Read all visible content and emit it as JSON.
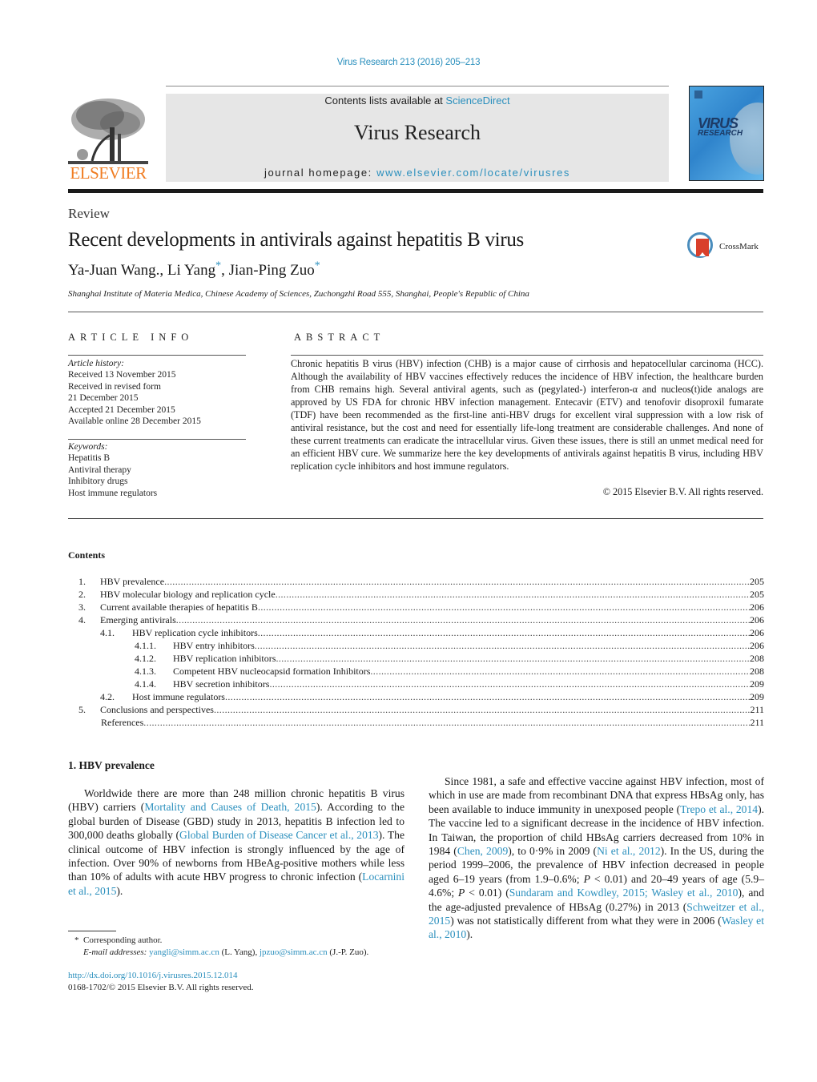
{
  "header": {
    "journal_ref": "Virus Research 213 (2016) 205–213",
    "contents_prefix": "Contents lists available at ",
    "contents_link": "ScienceDirect",
    "journal_name": "Virus Research",
    "homepage_prefix": "journal homepage: ",
    "homepage_link": "www.elsevier.com/locate/virusres",
    "publisher_logo_text": "ELSEVIER",
    "cover_title_1": "VIRUS",
    "cover_title_2": "RESEARCH",
    "crossmark_label": "CrossMark"
  },
  "article": {
    "type": "Review",
    "title": "Recent developments in antivirals against hepatitis B virus",
    "authors": [
      {
        "name": "Ya-Juan Wang.",
        "mark": ""
      },
      {
        "name": "Li Yang",
        "mark": "*"
      },
      {
        "name": "Jian-Ping Zuo",
        "mark": "*"
      }
    ],
    "author_sep": ", ",
    "affiliation": "Shanghai Institute of Materia Medica, Chinese Academy of Sciences, Zuchongzhi Road 555, Shanghai, People's Republic of China"
  },
  "article_info": {
    "heading": "ARTICLE INFO",
    "history_label": "Article history:",
    "history": [
      "Received 13 November 2015",
      "Received in revised form",
      "21 December 2015",
      "Accepted 21 December 2015",
      "Available online 28 December 2015"
    ],
    "keywords_label": "Keywords:",
    "keywords": [
      "Hepatitis B",
      "Antiviral therapy",
      "Inhibitory drugs",
      "Host immune regulators"
    ]
  },
  "abstract": {
    "heading": "ABSTRACT",
    "text": "Chronic hepatitis B virus (HBV) infection (CHB) is a major cause of cirrhosis and hepatocellular carcinoma (HCC). Although the availability of HBV vaccines effectively reduces the incidence of HBV infection, the healthcare burden from CHB remains high. Several antiviral agents, such as (pegylated-) interferon-α and nucleos(t)ide analogs are approved by US FDA for chronic HBV infection management. Entecavir (ETV) and tenofovir disoproxil fumarate (TDF) have been recommended as the first-line anti-HBV drugs for excellent viral suppression with a low risk of antiviral resistance, but the cost and need for essentially life-long treatment are considerable challenges. And none of these current treatments can eradicate the intracellular virus. Given these issues, there is still an unmet medical need for an efficient HBV cure. We summarize here the key developments of antivirals against hepatitis B virus, including HBV replication cycle inhibitors and host immune regulators.",
    "copyright": "© 2015 Elsevier B.V. All rights reserved."
  },
  "contents": {
    "heading": "Contents",
    "items": [
      {
        "num": "1.",
        "label": "HBV prevalence",
        "page": "205",
        "level": 0
      },
      {
        "num": "2.",
        "label": "HBV molecular biology and replication cycle",
        "page": "205",
        "level": 0
      },
      {
        "num": "3.",
        "label": "Current available therapies of hepatitis B",
        "page": "206",
        "level": 0
      },
      {
        "num": "4.",
        "label": "Emerging antivirals",
        "page": "206",
        "level": 0
      },
      {
        "num": "4.1.",
        "label": "HBV replication cycle inhibitors",
        "page": "206",
        "level": 1
      },
      {
        "num": "4.1.1.",
        "label": "HBV entry inhibitors",
        "page": "206",
        "level": 2
      },
      {
        "num": "4.1.2.",
        "label": "HBV replication inhibitors",
        "page": "208",
        "level": 2
      },
      {
        "num": "4.1.3.",
        "label": "Competent HBV nucleocapsid formation Inhibitors",
        "page": "208",
        "level": 2
      },
      {
        "num": "4.1.4.",
        "label": "HBV secretion inhibitors",
        "page": "209",
        "level": 2
      },
      {
        "num": "4.2.",
        "label": "Host immune regulators",
        "page": "209",
        "level": 1
      },
      {
        "num": "5.",
        "label": "Conclusions and perspectives",
        "page": "211",
        "level": 0
      },
      {
        "num": "",
        "label": "References",
        "page": "211",
        "level": 0
      }
    ]
  },
  "section1": {
    "heading": "1.  HBV prevalence",
    "para1": [
      {
        "t": "Worldwide there are more than 248 million chronic hepatitis B virus (HBV) carriers ("
      },
      {
        "t": "Mortality and Causes of Death, 2015",
        "link": true
      },
      {
        "t": "). According to the global burden of Disease (GBD) study in 2013, hepatitis B infection led to 300,000 deaths globally ("
      },
      {
        "t": "Global Burden of Disease Cancer et al., 2013",
        "link": true
      },
      {
        "t": "). The clinical outcome of HBV infection is strongly influenced by the age of infection. Over 90% of newborns from HBeAg-positive mothers while less than 10% of adults with acute HBV progress to chronic infection ("
      },
      {
        "t": "Locarnini et al., 2015",
        "link": true
      },
      {
        "t": ")."
      }
    ],
    "para2": [
      {
        "t": "Since 1981, a safe and effective vaccine against HBV infection, most of which in use are made from recombinant DNA that express HBsAg only, has been available to induce immunity in unexposed people ("
      },
      {
        "t": "Trepo et al., 2014",
        "link": true
      },
      {
        "t": "). The vaccine led to a significant decrease in the incidence of HBV infection. In Taiwan, the proportion of child HBsAg carriers decreased from 10% in 1984 ("
      },
      {
        "t": "Chen, 2009",
        "link": true
      },
      {
        "t": "), to 0·9% in 2009 ("
      },
      {
        "t": "Ni et al., 2012",
        "link": true
      },
      {
        "t": "). In the US, during the period 1999–2006, the prevalence of HBV infection decreased in people aged 6–19 years (from 1.9–0.6%; "
      },
      {
        "t": "P",
        "italic": true
      },
      {
        "t": " < 0.01) and 20–49 years of age (5.9–4.6%; "
      },
      {
        "t": "P",
        "italic": true
      },
      {
        "t": " < 0.01) ("
      },
      {
        "t": "Sundaram and Kowdley, 2015; Wasley et al., 2010",
        "link": true
      },
      {
        "t": "), and the age-adjusted prevalence of HBsAg (0.27%) in 2013 ("
      },
      {
        "t": "Schweitzer et al., 2015",
        "link": true
      },
      {
        "t": ") was not statistically different from what they were in 2006 ("
      },
      {
        "t": "Wasley et al., 2010",
        "link": true
      },
      {
        "t": ")."
      }
    ]
  },
  "footnote": {
    "marker": "*",
    "corresponding": "Corresponding author.",
    "email_label": "E-mail addresses:",
    "email1": "yangli@simm.ac.cn",
    "email1_owner": " (L. Yang), ",
    "email2": "jpzuo@simm.ac.cn",
    "email2_owner": " (J.-P. Zuo)."
  },
  "doi": {
    "link": "http://dx.doi.org/10.1016/j.virusres.2015.12.014",
    "issn": "0168-1702/© 2015 Elsevier B.V. All rights reserved."
  },
  "colors": {
    "link": "#2a8fbd",
    "elsevier_orange": "#f07c21",
    "banner_gray": "#e6e6e6"
  }
}
